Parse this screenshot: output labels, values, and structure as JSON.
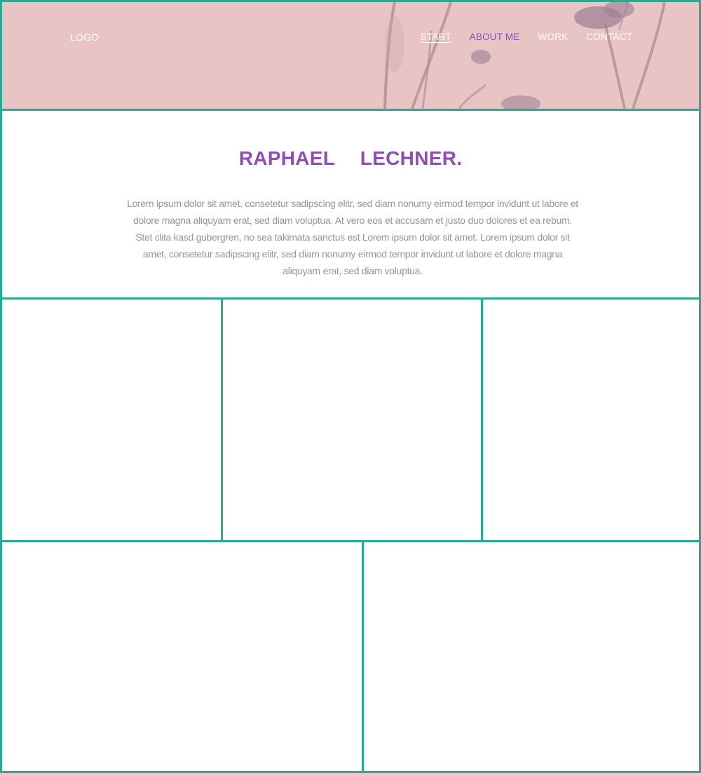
{
  "header": {
    "logo": "LOGO",
    "nav": [
      {
        "label": "START",
        "state": "active"
      },
      {
        "label": "ABOUT ME",
        "state": "highlight"
      },
      {
        "label": "WORK",
        "state": "normal"
      },
      {
        "label": "CONTACT",
        "state": "normal"
      }
    ],
    "background_color": "#e8c4c5"
  },
  "intro": {
    "title": "RAPHAEL  LECHNER.",
    "text": "Lorem ipsum dolor sit amet, consetetur sadipscing elitr, sed diam nonumy eirmod tempor invidunt ut labore et dolore magna aliquyam erat, sed diam voluptua. At vero eos et accusam et justo duo dolores et ea rebum. Stet clita kasd gubergren, no sea takimata sanctus est Lorem ipsum dolor sit amet. Lorem ipsum dolor sit amet, consetetur sadipscing elitr, sed diam nonumy eirmod tempor invidunt ut labore et dolore magna aliquyam erat, sed diam voluptua."
  },
  "colors": {
    "accent": "#8e4fb0",
    "border": "#2aaa92",
    "text_muted": "#8f9a97"
  }
}
